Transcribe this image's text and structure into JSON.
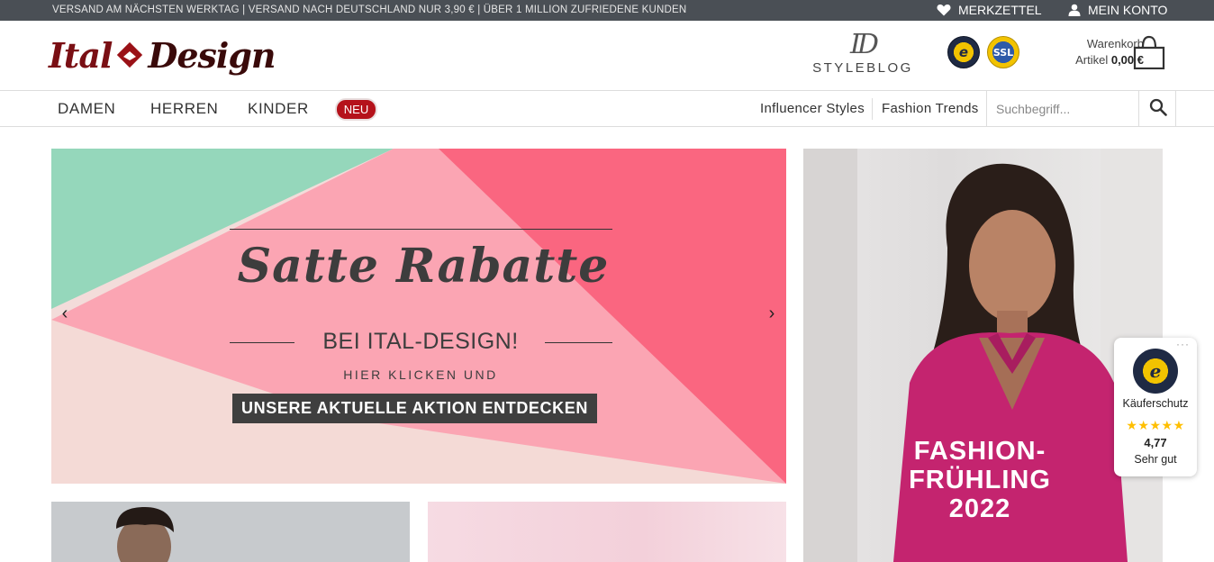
{
  "topbar": {
    "notice": "VERSAND AM NÄCHSTEN WERKTAG | VERSAND NACH DEUTSCHLAND NUR 3,90 € | ÜBER 1 MILLION ZUFRIEDENE KUNDEN",
    "wishlist": "MERKZETTEL",
    "account": "MEIN KONTO"
  },
  "header": {
    "logo_left": "Ital",
    "logo_right": "Design",
    "styleblog_mono": "ID",
    "styleblog": "STYLEBLOG",
    "ssl_seal": "SSL",
    "trusted_seal": "e",
    "cart_label": "Warenkorb",
    "cart_items_prefix": "Artikel",
    "cart_total": "0,00 €"
  },
  "nav": {
    "items": [
      "DAMEN",
      "HERREN",
      "KINDER"
    ],
    "badge": "NEU",
    "links": [
      "Influencer Styles",
      "Fashion Trends"
    ],
    "search_placeholder": "Suchbegriff..."
  },
  "slider": {
    "headline": "Satte Rabatte",
    "sub": "BEI ITAL-DESIGN!",
    "small": "HIER KLICKEN UND",
    "cta": "UNSERE AKTUELLE AKTION ENTDECKEN",
    "prev": "‹",
    "next": "›"
  },
  "promo": {
    "line1": "FASHION-",
    "line2": "FRÜHLING",
    "line3": "2022"
  },
  "trust_widget": {
    "menu": "···",
    "label": "Käuferschutz",
    "stars": "★★★★★",
    "score": "4,77",
    "grade": "Sehr gut"
  },
  "colors": {
    "topbar": "#4a4f55",
    "brand_red": "#b5121b",
    "slider_mint": "#95d7bb",
    "slider_pink": "#fba5b3",
    "slider_coral": "#fa6680",
    "promo_magenta": "#c4246f"
  }
}
